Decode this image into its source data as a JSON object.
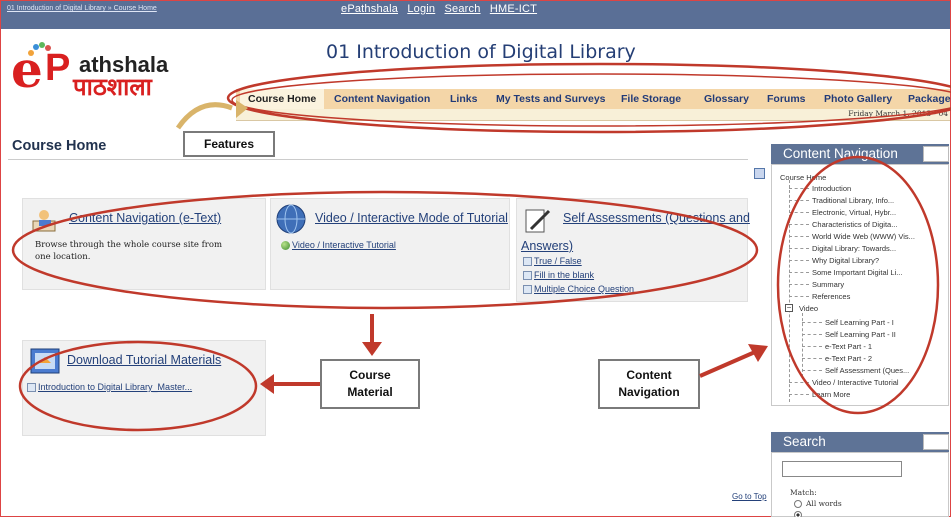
{
  "topbar": {
    "breadcrumb": "01 Introduction of Digital Library » Course Home",
    "links": [
      "ePathshala",
      "Login",
      "Search",
      "HME-ICT"
    ]
  },
  "logo": {
    "brand_letter": "e",
    "brand_p": "P",
    "brand_rest": "athshala",
    "brand_hindi": "पाठशाला"
  },
  "site_title": "01 Introduction of Digital Library",
  "nav": {
    "tabs": [
      {
        "label": "Course Home",
        "active": true
      },
      {
        "label": "Content Navigation",
        "active": false
      },
      {
        "label": "Links",
        "active": false
      },
      {
        "label": "My Tests and Surveys",
        "active": false
      },
      {
        "label": "File Storage",
        "active": false
      },
      {
        "label": "Glossary",
        "active": false
      },
      {
        "label": "Forums",
        "active": false
      },
      {
        "label": "Photo Gallery",
        "active": false
      },
      {
        "label": "Package",
        "active": false
      }
    ],
    "date": "Friday March 1, 2013 - 04"
  },
  "page_heading": "Course Home",
  "cards": {
    "content_nav": {
      "title": "Content Navigation (e-Text)",
      "description": "Browse through the whole course site from one location."
    },
    "video": {
      "title": "Video / Interactive Mode of Tutorial",
      "link": "Video / Interactive Tutorial"
    },
    "self_assessment": {
      "title_line1": "Self Assessments (Questions and",
      "title_line2": "Answers)",
      "links": [
        "True / False",
        "Fill in the blank",
        "Multiple Choice Question"
      ]
    },
    "download": {
      "title": "Download Tutorial Materials",
      "link": "Introduction to Digital Library_Master..."
    }
  },
  "annotations": {
    "features": "Features",
    "course_material_1": "Course",
    "course_material_2": "Material",
    "content_navigation_1": "Content",
    "content_navigation_2": "Navigation"
  },
  "panel_content_nav": {
    "title": "Content Navigation",
    "root": "Course Home",
    "items": [
      "Introduction",
      "Traditional Library, Info...",
      "Electronic, Virtual, Hybr...",
      "Characteristics of Digita...",
      "World Wide Web (WWW) Vis...",
      "Digital Library: Towards...",
      "Why Digital Library?",
      "Some Important Digital Li...",
      "Summary",
      "References"
    ],
    "folder": "Video",
    "folder_expander": "−",
    "folder_items": [
      "Self Learning Part - I",
      "Self Learning Part - II",
      "e-Text Part - 1",
      "e-Text Part - 2",
      "Self Assessment (Ques..."
    ],
    "tail_items": [
      "Video / Interactive Tutorial",
      "Learn More"
    ]
  },
  "panel_search": {
    "title": "Search",
    "match_label": "Match:",
    "options": [
      "All words"
    ]
  },
  "goto_top": "Go to Top",
  "colors": {
    "topbar": "#5a6f96",
    "nav_bg": "#f4d6a8",
    "annotation_red": "#c0392b",
    "link": "#24417a",
    "brand_red": "#d92020"
  }
}
